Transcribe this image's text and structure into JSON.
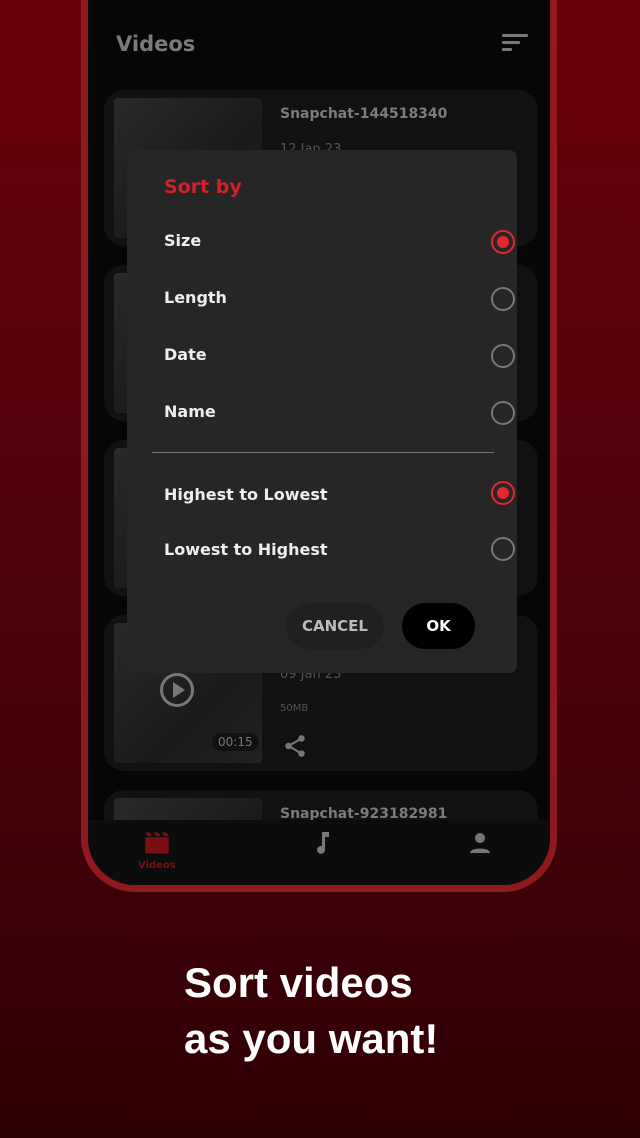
{
  "header": {
    "title": "Videos",
    "sort_icon": "sort-icon"
  },
  "videos": [
    {
      "name": "Snapchat-144518340",
      "date": "12 Jan 23",
      "size": "",
      "duration": ""
    },
    {
      "name": "",
      "date": "",
      "size": "",
      "duration": ""
    },
    {
      "name": "",
      "date": "",
      "size": "",
      "duration": ""
    },
    {
      "name": "",
      "date": "09 Jan 23",
      "size": "50MB",
      "duration": "00:15"
    },
    {
      "name": "Snapchat-923182981",
      "date": "",
      "size": "",
      "duration": ""
    }
  ],
  "dialog": {
    "title": "Sort by",
    "sort_fields": [
      {
        "label": "Size",
        "selected": true
      },
      {
        "label": "Length",
        "selected": false
      },
      {
        "label": "Date",
        "selected": false
      },
      {
        "label": "Name",
        "selected": false
      }
    ],
    "orders": [
      {
        "label": "Highest to Lowest",
        "selected": true
      },
      {
        "label": "Lowest to Highest",
        "selected": false
      }
    ],
    "cancel": "CANCEL",
    "ok": "OK"
  },
  "nav": {
    "items": [
      {
        "label": "Videos",
        "icon": "clapperboard-icon",
        "active": true
      },
      {
        "label": "",
        "icon": "music-note-icon"
      },
      {
        "label": "",
        "icon": "person-icon"
      }
    ]
  },
  "promo": {
    "line1": "Sort videos",
    "line2": "as you want!"
  },
  "colors": {
    "accent": "#e8252f",
    "frame": "#8e1a20",
    "dialog": "#262626"
  }
}
